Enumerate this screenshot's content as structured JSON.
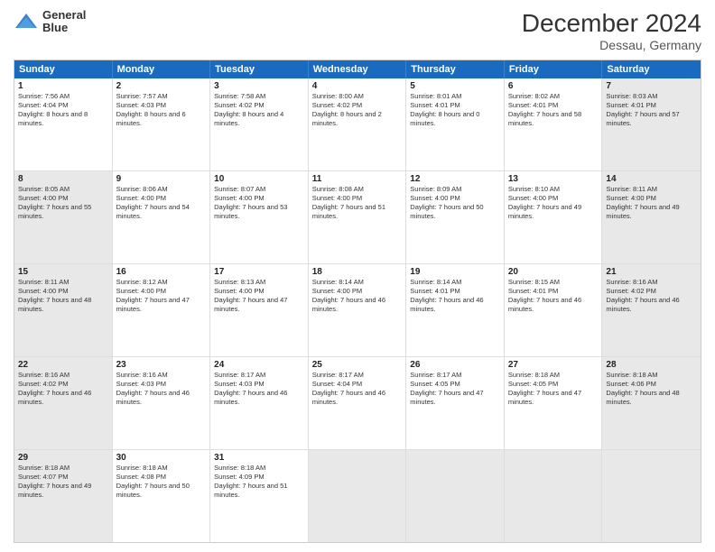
{
  "header": {
    "logo_line1": "General",
    "logo_line2": "Blue",
    "month": "December 2024",
    "location": "Dessau, Germany"
  },
  "days": [
    "Sunday",
    "Monday",
    "Tuesday",
    "Wednesday",
    "Thursday",
    "Friday",
    "Saturday"
  ],
  "rows": [
    [
      {
        "num": "1",
        "rise": "Sunrise: 7:56 AM",
        "set": "Sunset: 4:04 PM",
        "day": "Daylight: 8 hours and 8 minutes.",
        "shaded": false
      },
      {
        "num": "2",
        "rise": "Sunrise: 7:57 AM",
        "set": "Sunset: 4:03 PM",
        "day": "Daylight: 8 hours and 6 minutes.",
        "shaded": false
      },
      {
        "num": "3",
        "rise": "Sunrise: 7:58 AM",
        "set": "Sunset: 4:02 PM",
        "day": "Daylight: 8 hours and 4 minutes.",
        "shaded": false
      },
      {
        "num": "4",
        "rise": "Sunrise: 8:00 AM",
        "set": "Sunset: 4:02 PM",
        "day": "Daylight: 8 hours and 2 minutes.",
        "shaded": false
      },
      {
        "num": "5",
        "rise": "Sunrise: 8:01 AM",
        "set": "Sunset: 4:01 PM",
        "day": "Daylight: 8 hours and 0 minutes.",
        "shaded": false
      },
      {
        "num": "6",
        "rise": "Sunrise: 8:02 AM",
        "set": "Sunset: 4:01 PM",
        "day": "Daylight: 7 hours and 58 minutes.",
        "shaded": false
      },
      {
        "num": "7",
        "rise": "Sunrise: 8:03 AM",
        "set": "Sunset: 4:01 PM",
        "day": "Daylight: 7 hours and 57 minutes.",
        "shaded": true
      }
    ],
    [
      {
        "num": "8",
        "rise": "Sunrise: 8:05 AM",
        "set": "Sunset: 4:00 PM",
        "day": "Daylight: 7 hours and 55 minutes.",
        "shaded": true
      },
      {
        "num": "9",
        "rise": "Sunrise: 8:06 AM",
        "set": "Sunset: 4:00 PM",
        "day": "Daylight: 7 hours and 54 minutes.",
        "shaded": false
      },
      {
        "num": "10",
        "rise": "Sunrise: 8:07 AM",
        "set": "Sunset: 4:00 PM",
        "day": "Daylight: 7 hours and 53 minutes.",
        "shaded": false
      },
      {
        "num": "11",
        "rise": "Sunrise: 8:08 AM",
        "set": "Sunset: 4:00 PM",
        "day": "Daylight: 7 hours and 51 minutes.",
        "shaded": false
      },
      {
        "num": "12",
        "rise": "Sunrise: 8:09 AM",
        "set": "Sunset: 4:00 PM",
        "day": "Daylight: 7 hours and 50 minutes.",
        "shaded": false
      },
      {
        "num": "13",
        "rise": "Sunrise: 8:10 AM",
        "set": "Sunset: 4:00 PM",
        "day": "Daylight: 7 hours and 49 minutes.",
        "shaded": false
      },
      {
        "num": "14",
        "rise": "Sunrise: 8:11 AM",
        "set": "Sunset: 4:00 PM",
        "day": "Daylight: 7 hours and 49 minutes.",
        "shaded": true
      }
    ],
    [
      {
        "num": "15",
        "rise": "Sunrise: 8:11 AM",
        "set": "Sunset: 4:00 PM",
        "day": "Daylight: 7 hours and 48 minutes.",
        "shaded": true
      },
      {
        "num": "16",
        "rise": "Sunrise: 8:12 AM",
        "set": "Sunset: 4:00 PM",
        "day": "Daylight: 7 hours and 47 minutes.",
        "shaded": false
      },
      {
        "num": "17",
        "rise": "Sunrise: 8:13 AM",
        "set": "Sunset: 4:00 PM",
        "day": "Daylight: 7 hours and 47 minutes.",
        "shaded": false
      },
      {
        "num": "18",
        "rise": "Sunrise: 8:14 AM",
        "set": "Sunset: 4:00 PM",
        "day": "Daylight: 7 hours and 46 minutes.",
        "shaded": false
      },
      {
        "num": "19",
        "rise": "Sunrise: 8:14 AM",
        "set": "Sunset: 4:01 PM",
        "day": "Daylight: 7 hours and 46 minutes.",
        "shaded": false
      },
      {
        "num": "20",
        "rise": "Sunrise: 8:15 AM",
        "set": "Sunset: 4:01 PM",
        "day": "Daylight: 7 hours and 46 minutes.",
        "shaded": false
      },
      {
        "num": "21",
        "rise": "Sunrise: 8:16 AM",
        "set": "Sunset: 4:02 PM",
        "day": "Daylight: 7 hours and 46 minutes.",
        "shaded": true
      }
    ],
    [
      {
        "num": "22",
        "rise": "Sunrise: 8:16 AM",
        "set": "Sunset: 4:02 PM",
        "day": "Daylight: 7 hours and 46 minutes.",
        "shaded": true
      },
      {
        "num": "23",
        "rise": "Sunrise: 8:16 AM",
        "set": "Sunset: 4:03 PM",
        "day": "Daylight: 7 hours and 46 minutes.",
        "shaded": false
      },
      {
        "num": "24",
        "rise": "Sunrise: 8:17 AM",
        "set": "Sunset: 4:03 PM",
        "day": "Daylight: 7 hours and 46 minutes.",
        "shaded": false
      },
      {
        "num": "25",
        "rise": "Sunrise: 8:17 AM",
        "set": "Sunset: 4:04 PM",
        "day": "Daylight: 7 hours and 46 minutes.",
        "shaded": false
      },
      {
        "num": "26",
        "rise": "Sunrise: 8:17 AM",
        "set": "Sunset: 4:05 PM",
        "day": "Daylight: 7 hours and 47 minutes.",
        "shaded": false
      },
      {
        "num": "27",
        "rise": "Sunrise: 8:18 AM",
        "set": "Sunset: 4:05 PM",
        "day": "Daylight: 7 hours and 47 minutes.",
        "shaded": false
      },
      {
        "num": "28",
        "rise": "Sunrise: 8:18 AM",
        "set": "Sunset: 4:06 PM",
        "day": "Daylight: 7 hours and 48 minutes.",
        "shaded": true
      }
    ],
    [
      {
        "num": "29",
        "rise": "Sunrise: 8:18 AM",
        "set": "Sunset: 4:07 PM",
        "day": "Daylight: 7 hours and 49 minutes.",
        "shaded": true
      },
      {
        "num": "30",
        "rise": "Sunrise: 8:18 AM",
        "set": "Sunset: 4:08 PM",
        "day": "Daylight: 7 hours and 50 minutes.",
        "shaded": false
      },
      {
        "num": "31",
        "rise": "Sunrise: 8:18 AM",
        "set": "Sunset: 4:09 PM",
        "day": "Daylight: 7 hours and 51 minutes.",
        "shaded": false
      },
      {
        "num": "",
        "rise": "",
        "set": "",
        "day": "",
        "shaded": true
      },
      {
        "num": "",
        "rise": "",
        "set": "",
        "day": "",
        "shaded": true
      },
      {
        "num": "",
        "rise": "",
        "set": "",
        "day": "",
        "shaded": true
      },
      {
        "num": "",
        "rise": "",
        "set": "",
        "day": "",
        "shaded": true
      }
    ]
  ]
}
